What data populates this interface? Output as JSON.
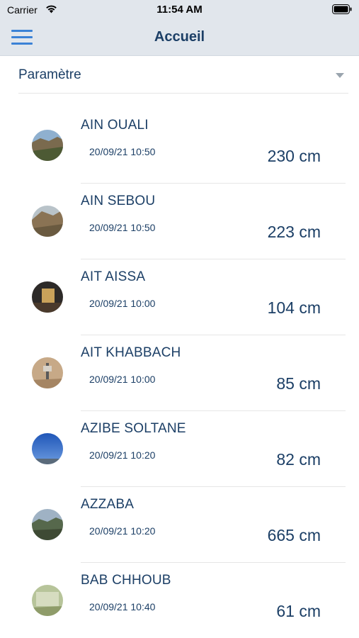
{
  "status": {
    "carrier": "Carrier",
    "time": "11:54 AM"
  },
  "nav": {
    "title": "Accueil",
    "menu_icon": "hamburger-menu-icon"
  },
  "filter": {
    "label": "Paramètre",
    "caret_icon": "dropdown-caret-icon"
  },
  "stations": [
    {
      "name": "AIN OUALI",
      "date": "20/09/21 10:50",
      "level": "230 cm"
    },
    {
      "name": "AIN SEBOU",
      "date": "20/09/21 10:50",
      "level": "223 cm"
    },
    {
      "name": "AIT AISSA",
      "date": "20/09/21 10:00",
      "level": "104 cm"
    },
    {
      "name": "AIT KHABBACH",
      "date": "20/09/21 10:00",
      "level": "85 cm"
    },
    {
      "name": "AZIBE SOLTANE",
      "date": "20/09/21 10:20",
      "level": "82 cm"
    },
    {
      "name": "AZZABA",
      "date": "20/09/21 10:20",
      "level": "665 cm"
    },
    {
      "name": "BAB CHHOUB",
      "date": "20/09/21 10:40",
      "level": "61 cm"
    }
  ],
  "colors": {
    "accent": "#3b82d6",
    "text": "#1c3f66",
    "bar": "#e1e6ec"
  }
}
